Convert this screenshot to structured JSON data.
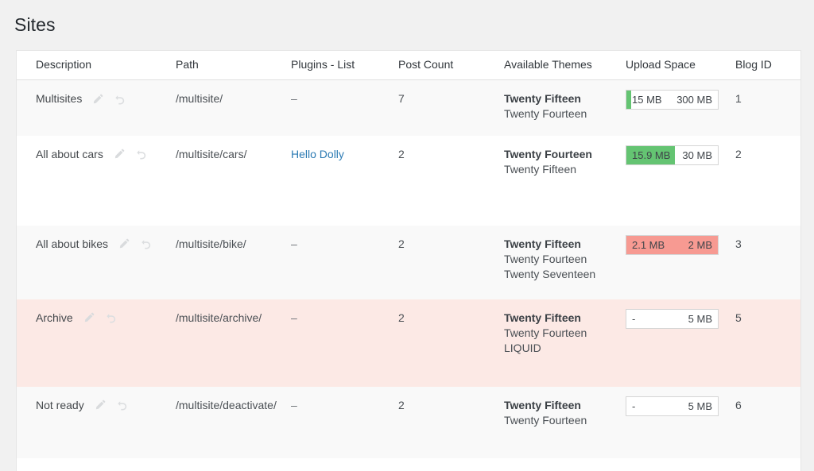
{
  "page": {
    "title": "Sites",
    "background_color": "#f1f1f1"
  },
  "colors": {
    "link": "#2b7ab3",
    "quota_ok": "#64c472",
    "quota_over": "#f79a92",
    "row_archived": "#fce9e5",
    "row_alt": "#f9f9f9",
    "text": "#44484c"
  },
  "table": {
    "columns": [
      {
        "key": "description",
        "label": "Description"
      },
      {
        "key": "path",
        "label": "Path"
      },
      {
        "key": "plugins",
        "label": "Plugins - List"
      },
      {
        "key": "post_count",
        "label": "Post Count"
      },
      {
        "key": "themes",
        "label": "Available Themes"
      },
      {
        "key": "upload_space",
        "label": "Upload Space"
      },
      {
        "key": "blog_id",
        "label": "Blog ID"
      }
    ],
    "row_actions": [
      {
        "name": "edit-icon",
        "title": "Edit"
      },
      {
        "name": "restore-icon",
        "title": "Restore"
      }
    ],
    "rows": [
      {
        "description": "Multisites",
        "path": "/multisite/",
        "plugins": "–",
        "plugins_is_link": false,
        "post_count": "7",
        "themes": [
          "Twenty Fifteen",
          "Twenty Fourteen"
        ],
        "upload": {
          "used": "15 MB",
          "total": "300 MB",
          "percent": 5,
          "over": false
        },
        "blog_id": "1",
        "style": "row-alt"
      },
      {
        "description": "All about cars",
        "path": "/multisite/cars/",
        "plugins": "Hello Dolly",
        "plugins_is_link": true,
        "post_count": "2",
        "themes": [
          "Twenty Fourteen",
          "Twenty Fifteen"
        ],
        "upload": {
          "used": "15.9 MB",
          "total": "30 MB",
          "percent": 53,
          "over": false
        },
        "blog_id": "2",
        "style": "row-plain"
      },
      {
        "description": "All about bikes",
        "path": "/multisite/bike/",
        "plugins": "–",
        "plugins_is_link": false,
        "post_count": "2",
        "themes": [
          "Twenty Fifteen",
          "Twenty Fourteen",
          "Twenty Seventeen"
        ],
        "upload": {
          "used": "2.1 MB",
          "total": "2 MB",
          "percent": 100,
          "over": true
        },
        "blog_id": "3",
        "style": "row-alt"
      },
      {
        "description": "Archive",
        "path": "/multisite/archive/",
        "plugins": "–",
        "plugins_is_link": false,
        "post_count": "2",
        "themes": [
          "Twenty Fifteen",
          "Twenty Fourteen",
          "LIQUID"
        ],
        "upload": {
          "used": "-",
          "total": "5 MB",
          "percent": 0,
          "over": false
        },
        "blog_id": "5",
        "style": "row-archived"
      },
      {
        "description": "Not ready",
        "path": "/multisite/deactivate/",
        "plugins": "–",
        "plugins_is_link": false,
        "post_count": "2",
        "themes": [
          "Twenty Fifteen",
          "Twenty Fourteen"
        ],
        "upload": {
          "used": "-",
          "total": "5 MB",
          "percent": 0,
          "over": false
        },
        "blog_id": "6",
        "style": "row-alt"
      }
    ]
  }
}
